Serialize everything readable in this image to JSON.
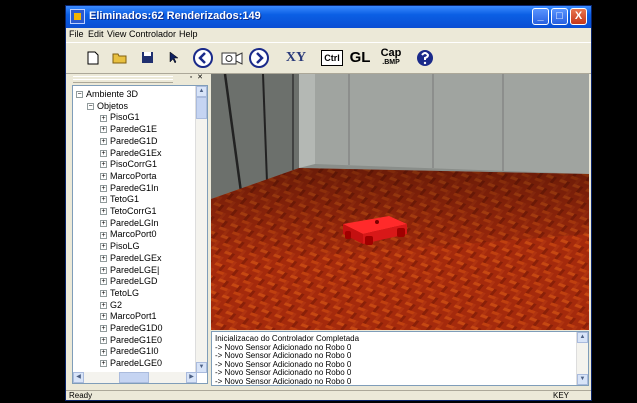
{
  "window": {
    "title": "Eliminados:62  Renderizados:149",
    "buttons": {
      "minimize": "_",
      "maximize": "□",
      "close": "X"
    }
  },
  "menu": [
    {
      "label": "File"
    },
    {
      "label": "Edit"
    },
    {
      "label": "View"
    },
    {
      "label": "Controlador"
    },
    {
      "label": "Help"
    }
  ],
  "toolbar": {
    "icons": [
      "new-file-icon",
      "open-folder-icon",
      "save-disk-icon",
      "pointer-arrow-icon",
      "rewind-icon",
      "camera-icon",
      "forward-icon"
    ],
    "xy_label": "XY",
    "ctrl_label": "Ctrl",
    "gl_label": "GL",
    "cap_label": "Cap",
    "cap_sub": ".BMP",
    "help_icon": "question-icon"
  },
  "tree": {
    "items": [
      {
        "label": "Ambiente 3D",
        "expander": "−"
      },
      {
        "label": "Objetos",
        "expander": "−"
      },
      {
        "label": "PisoG1",
        "expander": "+"
      },
      {
        "label": "ParedeG1E",
        "expander": "+"
      },
      {
        "label": "ParedeG1D",
        "expander": "+"
      },
      {
        "label": "ParedeG1Ex",
        "expander": "+"
      },
      {
        "label": "PisoCorrG1",
        "expander": "+"
      },
      {
        "label": "MarcoPorta",
        "expander": "+"
      },
      {
        "label": "ParedeG1In",
        "expander": "+"
      },
      {
        "label": "TetoG1",
        "expander": "+"
      },
      {
        "label": "TetoCorrG1",
        "expander": "+"
      },
      {
        "label": "ParedeLGIn",
        "expander": "+"
      },
      {
        "label": "MarcoPort0",
        "expander": "+"
      },
      {
        "label": "PisoLG",
        "expander": "+"
      },
      {
        "label": "ParedeLGEx",
        "expander": "+"
      },
      {
        "label": "ParedeLGE|",
        "expander": "+"
      },
      {
        "label": "ParedeLGD",
        "expander": "+"
      },
      {
        "label": "TetoLG",
        "expander": "+"
      },
      {
        "label": "G2",
        "expander": "+"
      },
      {
        "label": "MarcoPort1",
        "expander": "+"
      },
      {
        "label": "ParedeG1D0",
        "expander": "+"
      },
      {
        "label": "ParedeG1E0",
        "expander": "+"
      },
      {
        "label": "ParedeG1I0",
        "expander": "+"
      },
      {
        "label": "ParedeLGE0",
        "expander": "+"
      }
    ]
  },
  "console": {
    "lines": [
      "Inicializacao do Controlador Completada",
      " -> Novo Sensor Adicionado no Robo 0",
      " -> Novo Sensor Adicionado no Robo 0",
      " -> Novo Sensor Adicionado no Robo 0",
      " -> Novo Sensor Adicionado no Robo 0",
      " -> Novo Sensor Adicionado no Robo 0"
    ]
  },
  "status": {
    "left": "Ready",
    "right": "KEY"
  },
  "colors": {
    "titlebar": "#0b5fe4",
    "floor": "#a02a0a",
    "robot": "#e81a1a",
    "wall": "#9a9e9a"
  }
}
